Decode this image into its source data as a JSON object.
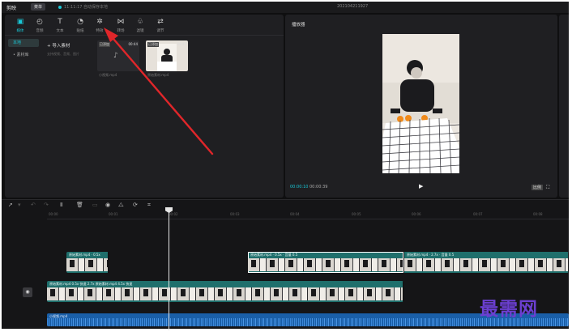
{
  "titlebar": {
    "app_name": "剪映",
    "menu_label": "菜单",
    "draft_info": "11:11:17 自动保存本地",
    "window_title": "202104211927"
  },
  "toolbar": [
    {
      "label": "媒体",
      "icon": "media-icon",
      "active": true
    },
    {
      "label": "音频",
      "icon": "audio-icon",
      "active": false
    },
    {
      "label": "文本",
      "icon": "text-icon",
      "active": false
    },
    {
      "label": "贴纸",
      "icon": "sticker-icon",
      "active": false
    },
    {
      "label": "特效",
      "icon": "effects-icon",
      "active": false
    },
    {
      "label": "转场",
      "icon": "transition-icon",
      "active": false
    },
    {
      "label": "滤镜",
      "icon": "filter-icon",
      "active": false
    },
    {
      "label": "调节",
      "icon": "adjust-icon",
      "active": false
    }
  ],
  "sidebar": [
    {
      "label": "本地",
      "active": true
    },
    {
      "label": "• 素材库",
      "active": false
    }
  ],
  "import": {
    "label": "+  导入素材",
    "hint": "支持视频、音频、图片"
  },
  "media_clips": [
    {
      "badge": "已添加",
      "duration": "00:44",
      "name": "小视频.mp4"
    },
    {
      "badge": "已添加",
      "duration": "00:47",
      "name": "原始素材.mp4"
    }
  ],
  "player": {
    "title": "播放器",
    "current_time": "00:00:10",
    "total_time": "00:00:39",
    "ratio_label": "比例",
    "play_icon": "play-icon",
    "fullscreen_icon": "fullscreen-icon"
  },
  "timeline": {
    "ruler_ticks": [
      "00:00",
      "00:01",
      "00:02",
      "00:03",
      "00:04",
      "00:05",
      "00:06",
      "00:07",
      "00:08"
    ],
    "track_top": [
      {
        "label": "原始素材.mp4 · 0.5x"
      },
      {
        "label": "原始素材.mp4 · 0.5x · 音量 0.5"
      },
      {
        "label": "原始素材.mp4 · 2.7x · 音量 0.5"
      }
    ],
    "track_main_label": "原始素材.mp4  0.5x  快速  2.7x  原始素材.mp4  4.5x  快速",
    "audio_label": "小视频.mp4"
  },
  "watermark": "最需网",
  "colors": {
    "accent": "#19c7d6",
    "video_track": "#1f6f6c",
    "audio_track": "#1a5fa8",
    "arrow": "#e0262a",
    "watermark": "#6b3fd0"
  }
}
